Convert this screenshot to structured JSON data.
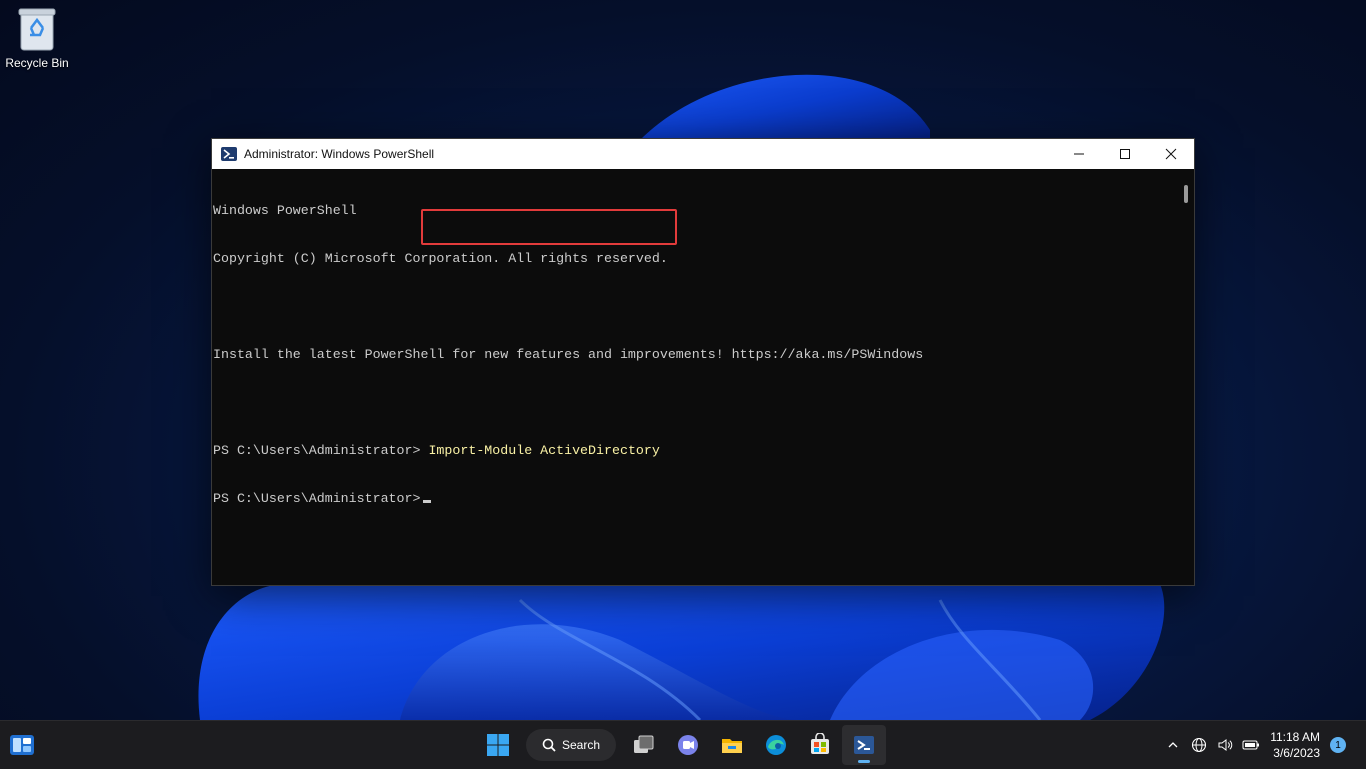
{
  "desktop": {
    "recycle_bin_label": "Recycle Bin"
  },
  "window": {
    "title": "Administrator: Windows PowerShell",
    "console_lines": [
      "Windows PowerShell",
      "Copyright (C) Microsoft Corporation. All rights reserved.",
      "",
      "Install the latest PowerShell for new features and improvements! https://aka.ms/PSWindows",
      ""
    ],
    "prompt": "PS C:\\Users\\Administrator>",
    "command": "Import-Module ActiveDirectory",
    "highlight_color": "#e23b3b"
  },
  "taskbar": {
    "search_label": "Search",
    "time": "11:18 AM",
    "date": "3/6/2023",
    "notification_count": "1",
    "apps": [
      "start-icon",
      "search",
      "task-view-icon",
      "chat-icon",
      "file-explorer-icon",
      "edge-icon",
      "store-icon",
      "powershell-icon"
    ],
    "tray_icons": [
      "chevron-up-icon",
      "network-icon",
      "volume-icon",
      "battery-icon"
    ]
  },
  "colors": {
    "accent": "#5fb2f2",
    "console_bg": "#0c0c0c",
    "console_text": "#cccccc",
    "command_text": "#f9f1a5"
  }
}
